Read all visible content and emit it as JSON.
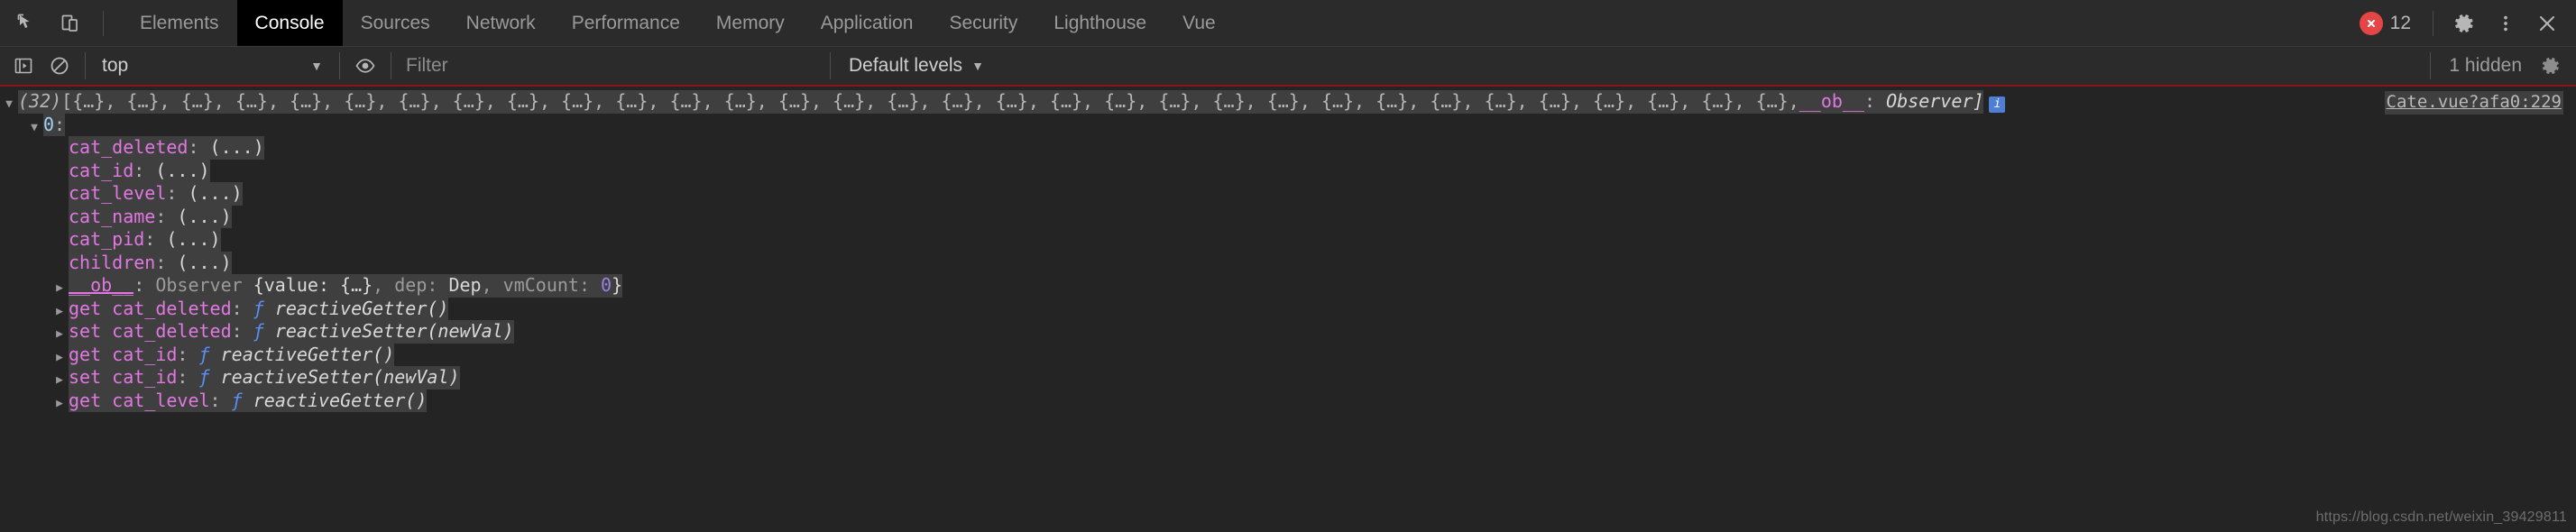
{
  "tabbar": {
    "icons": [
      {
        "name": "inspect-element-icon",
        "title": "Inspect"
      },
      {
        "name": "device-toolbar-icon",
        "title": "Toggle device toolbar"
      }
    ],
    "tabs": [
      {
        "label": "Elements",
        "active": false
      },
      {
        "label": "Console",
        "active": true
      },
      {
        "label": "Sources",
        "active": false
      },
      {
        "label": "Network",
        "active": false
      },
      {
        "label": "Performance",
        "active": false
      },
      {
        "label": "Memory",
        "active": false
      },
      {
        "label": "Application",
        "active": false
      },
      {
        "label": "Security",
        "active": false
      },
      {
        "label": "Lighthouse",
        "active": false
      },
      {
        "label": "Vue",
        "active": false
      }
    ],
    "error_count": "12",
    "settings_icon": "gear-icon",
    "more_icon": "kebab-menu-icon",
    "close_icon": "close-icon"
  },
  "toolbar": {
    "sidebar_toggle_icon": "console-sidebar-icon",
    "clear_icon": "clear-console-icon",
    "context": "top",
    "context_arrow": "▼",
    "live_expression_icon": "eye-icon",
    "filter_placeholder": "Filter",
    "filter_value": "",
    "levels": "Default levels",
    "levels_arrow": "▼",
    "hidden_count": "1 hidden",
    "settings_icon": "console-settings-gear-icon"
  },
  "console": {
    "source_link": "Cate.vue?afa0:229",
    "array_header": {
      "count": "(32)",
      "preview": "[{…}, {…}, {…}, {…}, {…}, {…}, {…}, {…}, {…}, {…}, {…}, {…}, {…}, {…}, {…}, {…}, {…}, {…}, {…}, {…}, {…}, {…}, {…}, {…}, {…}, {…}, {…}, {…}, {…}, {…}, {…}, {…},",
      "ob_key": "__ob__",
      "ob_sep": ": ",
      "ob_value": "Observer]",
      "info_badge": "i"
    },
    "index_row": {
      "key": "0",
      "colon": ":"
    },
    "properties": [
      {
        "name": "cat_deleted",
        "value": "(...)"
      },
      {
        "name": "cat_id",
        "value": "(...)"
      },
      {
        "name": "cat_level",
        "value": "(...)"
      },
      {
        "name": "cat_name",
        "value": "(...)"
      },
      {
        "name": "cat_pid",
        "value": "(...)"
      },
      {
        "name": "children",
        "value": "(...)"
      }
    ],
    "observer_row": {
      "key": "__ob__",
      "colon": ": ",
      "classname": "Observer ",
      "body_open": "{value: ",
      "body_val": "{…}",
      "body_mid": ", dep: ",
      "body_dep": "Dep",
      "body_mid2": ", vmCount: ",
      "body_num": "0",
      "body_close": "}"
    },
    "accessors": [
      {
        "kind": "get ",
        "name": "cat_deleted",
        "colon": ": ",
        "f": "ƒ",
        "fn": "reactiveGetter()"
      },
      {
        "kind": "set ",
        "name": "cat_deleted",
        "colon": ": ",
        "f": "ƒ",
        "fn": "reactiveSetter(newVal)"
      },
      {
        "kind": "get ",
        "name": "cat_id",
        "colon": ": ",
        "f": "ƒ",
        "fn": "reactiveGetter()"
      },
      {
        "kind": "set ",
        "name": "cat_id",
        "colon": ": ",
        "f": "ƒ",
        "fn": "reactiveSetter(newVal)"
      },
      {
        "kind": "get ",
        "name": "cat_level",
        "colon": ": ",
        "f": "ƒ",
        "fn": "reactiveGetter()"
      }
    ]
  },
  "watermark": "https://blog.csdn.net/weixin_39429811",
  "colors": {
    "tab_active_bg": "#000000",
    "error_red": "#e64545",
    "toolbar_border": "#8b1515",
    "property_magenta": "#e178e1",
    "function_blue": "#5b8ef5",
    "number_violet": "#9a7fe8",
    "index_blue": "#9fd4f5"
  }
}
